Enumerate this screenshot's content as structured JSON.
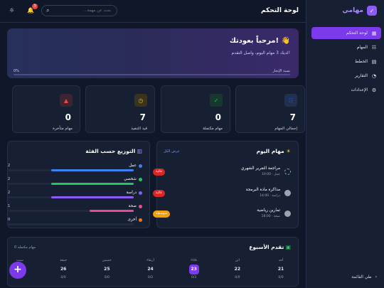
{
  "app": {
    "name": "مهامي",
    "page_title": "لوحة التحكم"
  },
  "sidebar": {
    "items": [
      {
        "label": "لوحة التحكم",
        "icon": "grid-icon",
        "active": true
      },
      {
        "label": "المهام",
        "icon": "checklist-icon"
      },
      {
        "label": "الخطط",
        "icon": "calendar-icon"
      },
      {
        "label": "التقارير",
        "icon": "pie-chart-icon"
      },
      {
        "label": "الإعدادات",
        "icon": "gear-icon"
      }
    ],
    "collapse_label": "طي القائمة"
  },
  "topbar": {
    "search_placeholder": "بحث عن مهمة...",
    "notifications": "3"
  },
  "hero": {
    "title": "مرحباً بعودتك! 👋",
    "subtitle": "لديك 3 مهام اليوم، واصل التقدم!",
    "progress_label": "نسبة الإنجاز",
    "progress_value": "0%",
    "progress": 0
  },
  "stats": [
    {
      "value": "7",
      "label": "إجمالي المهام",
      "icon": "list-icon",
      "color": "#1d4ed8",
      "bg": "#22304f"
    },
    {
      "value": "0",
      "label": "مهام مكتملة",
      "icon": "check-circle-icon",
      "color": "#22c55e",
      "bg": "#18372f"
    },
    {
      "value": "7",
      "label": "قيد التنفيذ",
      "icon": "clock-icon",
      "color": "#eab308",
      "bg": "#393320"
    },
    {
      "value": "0",
      "label": "مهام متأخرة",
      "icon": "warning-icon",
      "color": "#ef4444",
      "bg": "#3b2533"
    }
  ],
  "today": {
    "title": "مهام اليوم",
    "show_all": "عرض الكل",
    "tasks": [
      {
        "title": "مراجعة التقرير الشهري",
        "meta": "10:00 · عمل",
        "priority": "عالية",
        "color": "#dc2626",
        "dashed": true
      },
      {
        "title": "مذاكرة مادة البرمجة",
        "meta": "14:00 · دراسة",
        "priority": "عالية",
        "color": "#dc2626"
      },
      {
        "title": "تمارين رياضية",
        "meta": "18:00 · صحة",
        "priority": "متوسطة",
        "color": "#f59e0b"
      }
    ]
  },
  "categories": {
    "title": "التوزيع حسب الفئة",
    "items": [
      {
        "name": "عمل",
        "count": "2",
        "fraction": 0.65,
        "color": "#3b82f6"
      },
      {
        "name": "شخصي",
        "count": "2",
        "fraction": 0.65,
        "color": "#22c55e"
      },
      {
        "name": "دراسة",
        "count": "2",
        "fraction": 0.65,
        "color": "#8b5cf6"
      },
      {
        "name": "صحة",
        "count": "1",
        "fraction": 0.35,
        "color": "#ec4899"
      },
      {
        "name": "أخرى",
        "count": "0",
        "fraction": 0,
        "color": "#f97316"
      }
    ]
  },
  "week": {
    "title": "تقدم الأسبوع",
    "summary": "0 مهام مكتملة",
    "days": [
      {
        "name": "أحد",
        "num": "21",
        "ratio": "0/0"
      },
      {
        "name": "اثن",
        "num": "22",
        "ratio": "0/0"
      },
      {
        "name": "ثلاثاء",
        "num": "23",
        "ratio": "0/3",
        "today": true
      },
      {
        "name": "أربعاء",
        "num": "24",
        "ratio": "0/2"
      },
      {
        "name": "خميس",
        "num": "25",
        "ratio": "0/0"
      },
      {
        "name": "جمعة",
        "num": "26",
        "ratio": "0/0"
      },
      {
        "name": "سبت",
        "num": "27",
        "ratio": "0/0"
      }
    ]
  }
}
